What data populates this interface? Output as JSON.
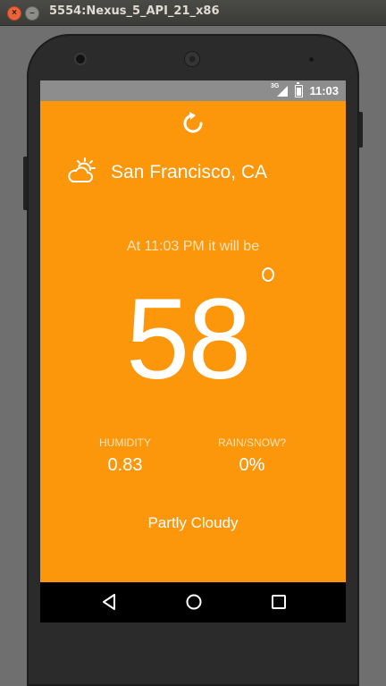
{
  "window": {
    "title": "5554:Nexus_5_API_21_x86",
    "close_glyph": "×",
    "min_glyph": "–"
  },
  "status_bar": {
    "network": "3G",
    "time": "11:03"
  },
  "weather": {
    "location": "San Francisco, CA",
    "time_line": "At 11:03 PM it will be",
    "temperature": "58",
    "humidity_label": "HUMIDITY",
    "humidity_value": "0.83",
    "rain_label": "RAIN/SNOW?",
    "rain_value": "0%",
    "summary": "Partly Cloudy",
    "icon": "partly-cloudy-day-icon"
  },
  "colors": {
    "app_background": "#fc970b",
    "status_bar": "#8d8d8d",
    "nav_bar": "#000000"
  },
  "nav": {
    "back": "back-icon",
    "home": "home-icon",
    "recents": "recents-icon"
  }
}
